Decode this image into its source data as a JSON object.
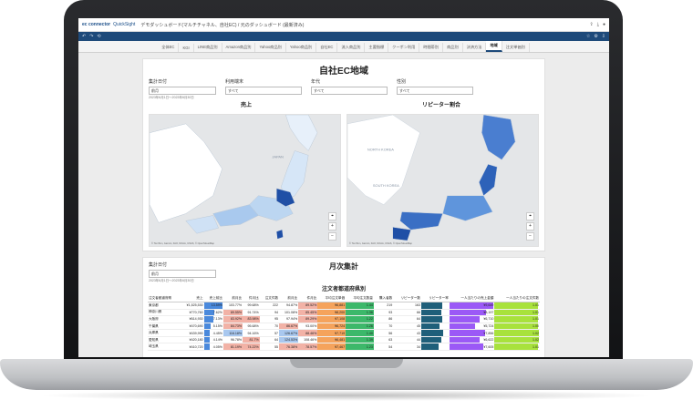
{
  "app": {
    "logo": "ec connector",
    "product": "QuickSight",
    "breadcrumb": "デモダッシュボード(マルチチャネル、自社EC) / 元のダッシュボード (最新済み)"
  },
  "tabs": [
    {
      "label": "全体EC",
      "active": false
    },
    {
      "label": "KGI",
      "active": false
    },
    {
      "label": "LINE商品別",
      "active": false
    },
    {
      "label": "Amazon商品別",
      "active": false
    },
    {
      "label": "Yahoo商品別",
      "active": false
    },
    {
      "label": "Yahoo商品別",
      "active": false
    },
    {
      "label": "自社EC",
      "active": false
    },
    {
      "label": "流入商品別",
      "active": false
    },
    {
      "label": "主要指標",
      "active": false
    },
    {
      "label": "クーポン利用",
      "active": false
    },
    {
      "label": "時間帯別",
      "active": false
    },
    {
      "label": "商品別",
      "active": false
    },
    {
      "label": "決済方法",
      "active": false
    },
    {
      "label": "地域",
      "active": true
    },
    {
      "label": "注文単価別",
      "active": false
    }
  ],
  "sheet1": {
    "title": "自社EC地域",
    "filters": [
      {
        "label": "集計日付",
        "value": "前月",
        "note": "2023年6月1日〜2023年6月30日"
      },
      {
        "label": "利用端末",
        "value": "すべて"
      },
      {
        "label": "年代",
        "value": "すべて"
      },
      {
        "label": "性別",
        "value": "すべて"
      }
    ],
    "map_left_title": "売上",
    "map_right_title": "リピーター割合",
    "map_attribution": "© TomTom, Garmin, FAO, NOAA, USGS, © OpenStreetMap",
    "map_labels": [
      "JAPAN",
      "NORTH KOREA",
      "SOUTH KOREA"
    ]
  },
  "sheet2": {
    "title": "月次集計",
    "filter_label": "集計日付",
    "filter_value": "前月",
    "filter_note": "2023年6月1日〜2023年6月30日",
    "table_title": "注文者都道府県別"
  },
  "table": {
    "headers": [
      "注文者都道府県",
      "売上",
      "売上前比",
      "前月比",
      "件月比",
      "注文件数",
      "前月比",
      "件月比",
      "平均注文単価",
      "平均注文数量",
      "購入者数",
      "リピーター数",
      "リピーター率",
      "一人当たりの売上金額",
      "一人当たりの注文件数"
    ],
    "rows": [
      [
        "東京都",
        "¥1,525,530",
        "13.59%",
        "103.77%",
        "99.68%",
        "222",
        "94.87%",
        "89.52%",
        "¥6,881",
        "1.44",
        "219",
        "163",
        "",
        "¥9,649",
        "1.01"
      ],
      [
        "神奈川県",
        "¥770,760",
        "7.62%",
        "89.55%",
        "91.74%",
        "94",
        "101.08%",
        "85.45%",
        "¥8,200",
        "1.36",
        "93",
        "66",
        "",
        "¥8,197",
        "1.01"
      ],
      [
        "大阪府",
        "¥614,930",
        "7.13%",
        "83.92%",
        "83.98%",
        "95",
        "97.94%",
        "89.29%",
        "¥7,108",
        "1.22",
        "86",
        "64",
        "",
        "¥6,710",
        "1.01"
      ],
      [
        "千葉県",
        "¥470,690",
        "5.15%",
        "84.73%",
        "95.68%",
        "70",
        "86.67%",
        "93.00%",
        "¥6,724",
        "1.26",
        "70",
        "45",
        "",
        "¥5,724",
        "1.00"
      ],
      [
        "兵庫県",
        "¥439,990",
        "4.45%",
        "116.18%",
        "94.16%",
        "57",
        "126.67%",
        "88.46%",
        "¥7,719",
        "1.40",
        "56",
        "43",
        "",
        "¥7,856",
        "1.02"
      ],
      [
        "愛知県",
        "¥420,180",
        "4.14%",
        "96.78%",
        "81.7%",
        "64",
        "124.53%",
        "108.46%",
        "¥6,481",
        "1.39",
        "63",
        "44",
        "",
        "¥6,622",
        "1.02"
      ],
      [
        "埼玉県",
        "¥410,720",
        "4.05%",
        "81.19%",
        "74.22%",
        "55",
        "76.38%",
        "78.57%",
        "¥7,467",
        "1.23",
        "54",
        "34",
        "",
        "¥7,605",
        "1.01"
      ]
    ],
    "repeat_rates": [
      0.74,
      0.71,
      0.74,
      0.64,
      0.77,
      0.7,
      0.63
    ],
    "per_person_sales": [
      9649,
      8197,
      6710,
      5724,
      7856,
      6622,
      7605
    ],
    "per_person_orders": [
      1.01,
      1.01,
      1.01,
      1.0,
      1.02,
      1.02,
      1.01
    ],
    "share_values": [
      13.59,
      7.62,
      7.13,
      5.15,
      4.45,
      4.14,
      4.05
    ]
  },
  "colors": {
    "nav": "#1e4a7a",
    "bar_blue": "#4a89dc",
    "bar_teal": "#1f5f7a",
    "bar_purple": "#9b59f6",
    "bar_lime": "#a8e23c",
    "heat_red": "#f2b2a6",
    "heat_blue": "#a9c8ef",
    "heat_orange": "#f5a35c",
    "heat_green": "#3cb86a"
  }
}
